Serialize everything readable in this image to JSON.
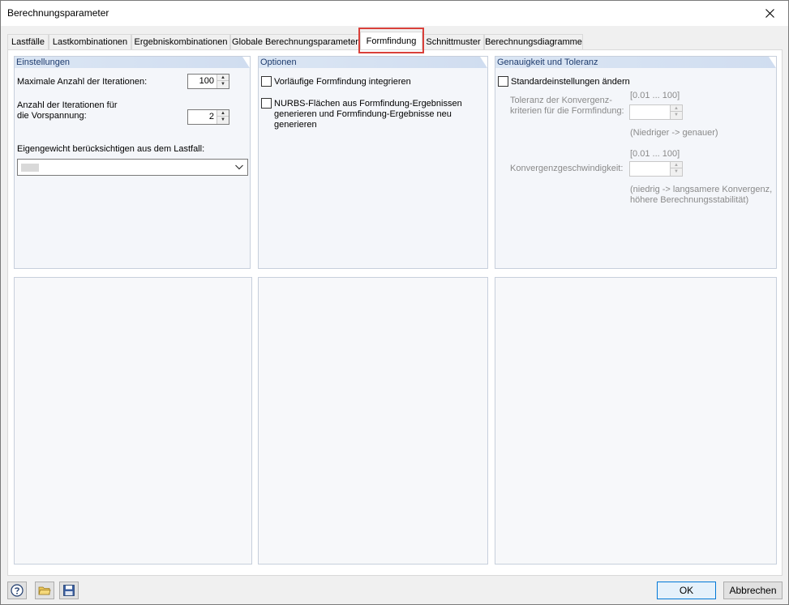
{
  "window": {
    "title": "Berechnungsparameter"
  },
  "tabs": [
    {
      "label": "Lastfälle"
    },
    {
      "label": "Lastkombinationen"
    },
    {
      "label": "Ergebniskombinationen"
    },
    {
      "label": "Globale Berechnungsparameter"
    },
    {
      "label": "Formfindung",
      "active": true
    },
    {
      "label": "Schnittmuster"
    },
    {
      "label": "Berechnungsdiagramme"
    }
  ],
  "settings": {
    "header": "Einstellungen",
    "max_iter_label": "Maximale Anzahl der Iterationen:",
    "max_iter_value": "100",
    "prestress_label_1": "Anzahl der Iterationen für",
    "prestress_label_2": "die Vorspannung:",
    "prestress_value": "2",
    "selfweight_label": "Eigengewicht berücksichtigen aus dem Lastfall:",
    "selfweight_value": ""
  },
  "options": {
    "header": "Optionen",
    "option1": "Vorläufige Formfindung integrieren",
    "option2_line1": "NURBS-Flächen aus Formfindung-Ergebnissen",
    "option2_line2": "generieren und Formfindung-Ergebnisse neu",
    "option2_line3": "generieren"
  },
  "accuracy": {
    "header": "Genauigkeit und Toleranz",
    "change_defaults": "Standardeinstellungen ändern",
    "range1": "[0.01 ... 100]",
    "tolerance_label_1": "Toleranz der Konvergenz-",
    "tolerance_label_2": "kriterien für die Formfindung:",
    "tolerance_hint": "(Niedriger -> genauer)",
    "range2": "[0.01 ... 100]",
    "speed_label": "Konvergenzgeschwindigkeit:",
    "speed_hint_1": "(niedrig -> langsamere Konvergenz,",
    "speed_hint_2": "höhere Berechnungsstabilität)"
  },
  "buttons": {
    "ok": "OK",
    "cancel": "Abbrechen"
  },
  "colors": {
    "highlight": "#d9403a",
    "panel_header_text": "#1f3c6e",
    "accent": "#0078d7"
  }
}
